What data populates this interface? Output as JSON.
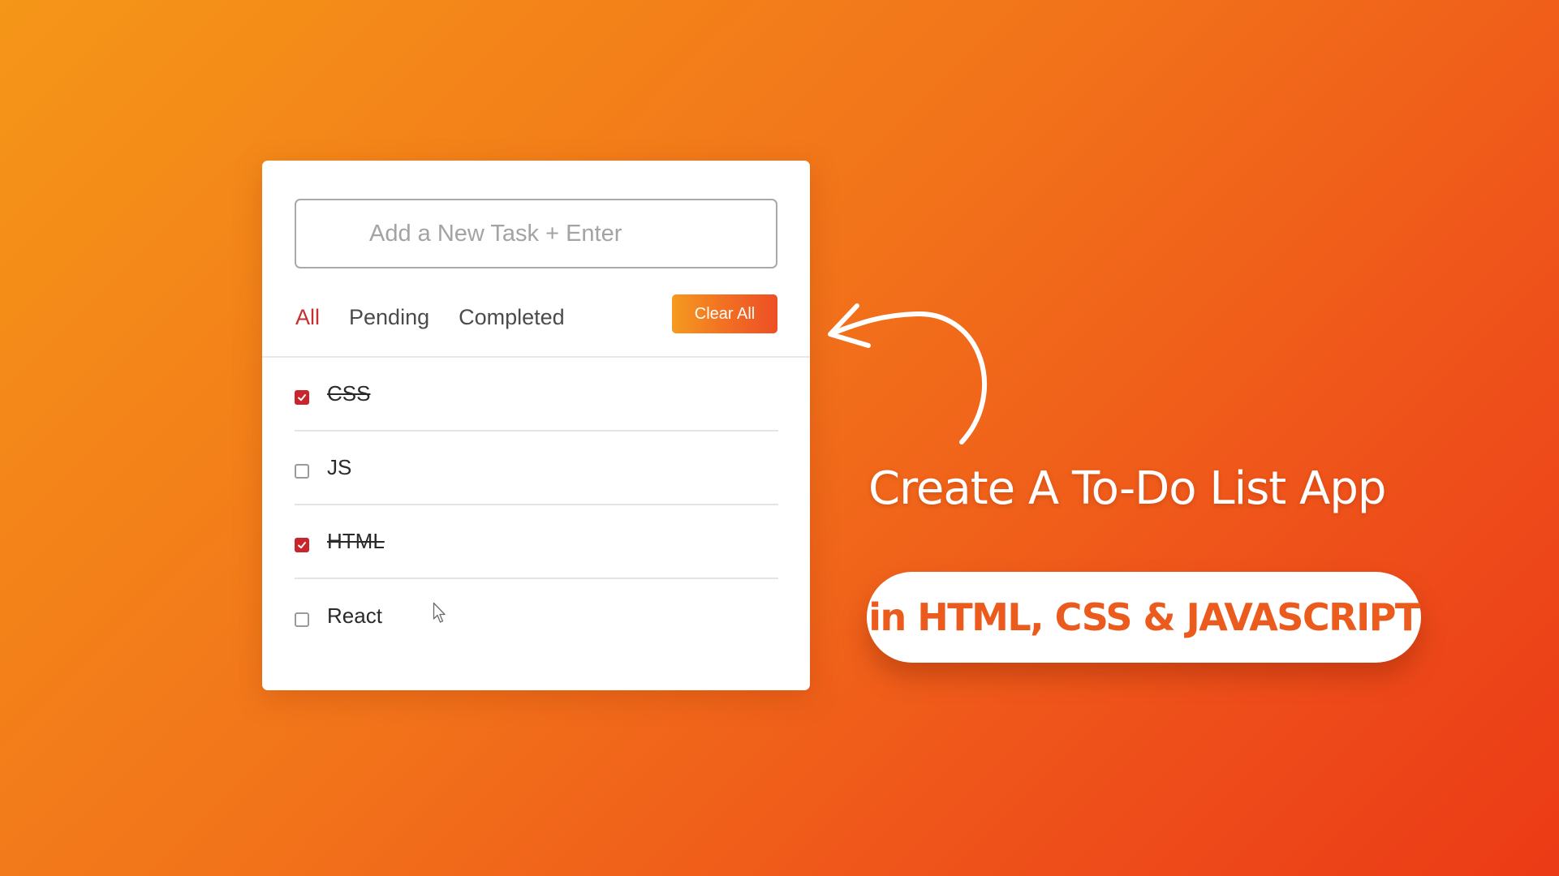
{
  "todo": {
    "input": {
      "placeholder": "Add a New Task + Enter",
      "value": ""
    },
    "filters": [
      {
        "label": "All",
        "active": true
      },
      {
        "label": "Pending",
        "active": false
      },
      {
        "label": "Completed",
        "active": false
      }
    ],
    "clear_label": "Clear All",
    "tasks": [
      {
        "label": "CSS",
        "done": true
      },
      {
        "label": "JS",
        "done": false
      },
      {
        "label": "HTML",
        "done": true
      },
      {
        "label": "React",
        "done": false
      }
    ]
  },
  "banner": {
    "headline": "Create A To-Do List App",
    "pill_text": "in HTML, CSS & JAVASCRIPT"
  },
  "colors": {
    "accent_red": "#c8262c",
    "pill_text": "#ec5b1e",
    "background_start": "#f59618",
    "background_end": "#eb3a16"
  },
  "icons": {
    "arrow": "curved-arrow-icon",
    "cursor": "mouse-pointer-icon",
    "check": "check-icon"
  }
}
